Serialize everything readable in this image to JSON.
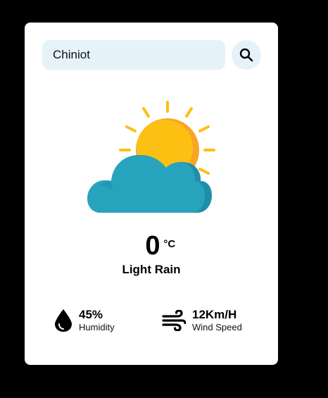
{
  "search": {
    "value": "Chiniot"
  },
  "weather": {
    "temperature": "0",
    "unit": "°C",
    "condition": "Light Rain",
    "icon": "sun-behind-cloud-icon"
  },
  "details": {
    "humidity": {
      "value": "45%",
      "label": "Humidity",
      "icon": "water-drop-icon"
    },
    "wind": {
      "value": "12Km/H",
      "label": "Wind Speed",
      "icon": "wind-icon"
    }
  },
  "colors": {
    "background": "#000000",
    "card": "#ffffff",
    "input_bg": "#e6f2fa",
    "sun": "#fcc013",
    "cloud": "#28a3bd"
  }
}
